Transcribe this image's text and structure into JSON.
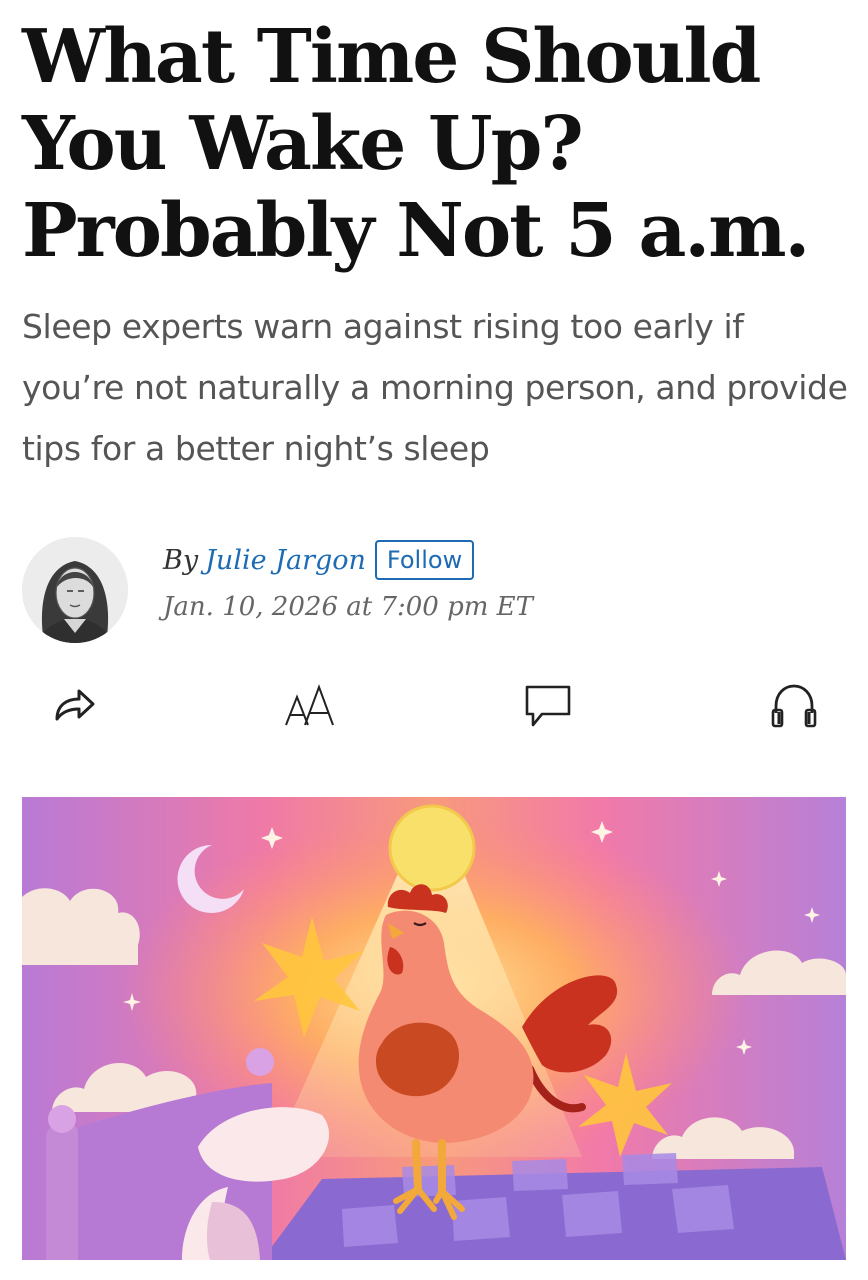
{
  "article": {
    "headline": "What Time Should You Wake Up? Probably Not 5 a.m.",
    "dek": "Sleep experts warn against rising too early if you’re not naturally a morning person, and provide tips for a better night’s sleep"
  },
  "byline": {
    "prefix": "By",
    "author": "Julie Jargon",
    "follow_label": "Follow",
    "timestamp": "Jan. 10, 2026 at 7:00 pm ET"
  },
  "toolbar": {
    "items": [
      {
        "icon": "share-icon"
      },
      {
        "icon": "text-size-icon"
      },
      {
        "icon": "comment-icon"
      },
      {
        "icon": "headphones-icon"
      }
    ]
  },
  "colors": {
    "link": "#1d6bb2",
    "headline": "#111111",
    "dek": "#555555"
  },
  "hero_image": {
    "subject": "rooster crowing on a bed under a rising sun"
  }
}
